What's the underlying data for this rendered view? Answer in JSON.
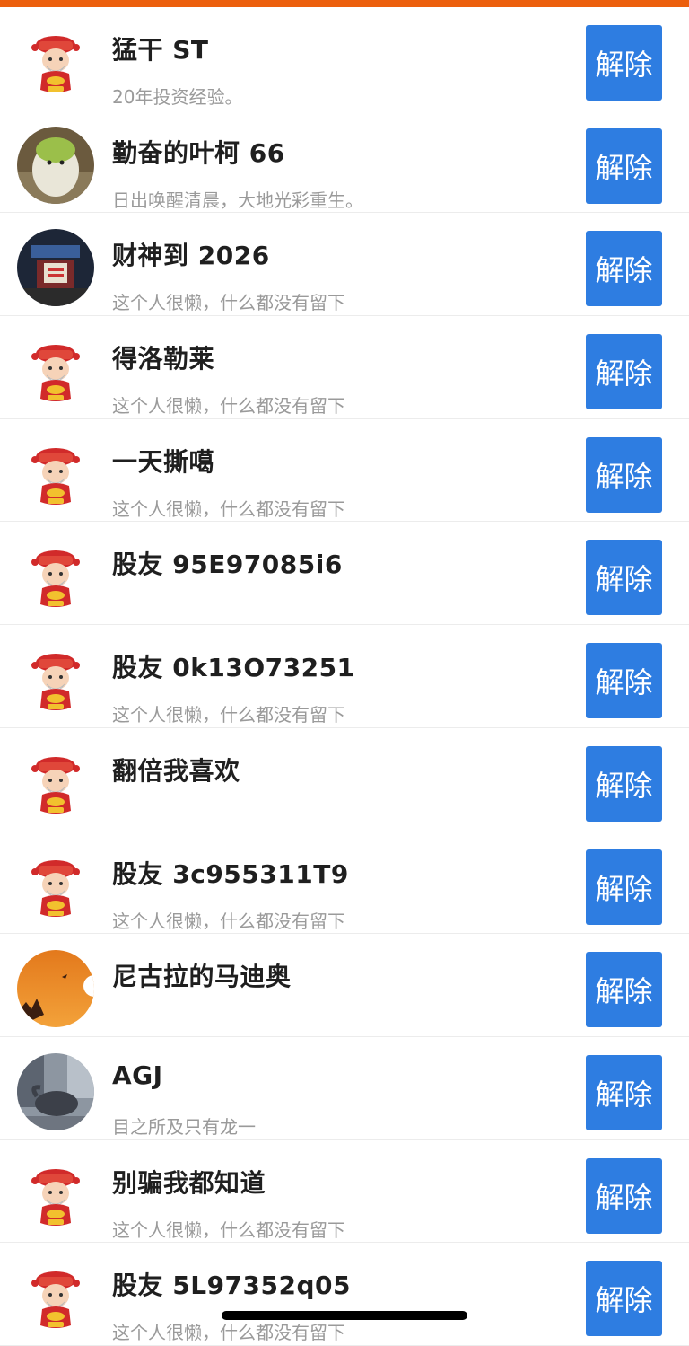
{
  "colors": {
    "accent_top": "#ec5f0d",
    "button_bg": "#2e7de1",
    "name_text": "#1f1f1f",
    "bio_text": "#9a9a9a"
  },
  "remove_label": "解除",
  "rows": [
    {
      "name": "猛干 ST",
      "bio": "20年投资经验。",
      "avatar": "caishen-avatar"
    },
    {
      "name": "勤奋的叶柯 66",
      "bio": "日出唤醒清晨，大地光彩重生。",
      "avatar": "plush-avatar"
    },
    {
      "name": "财神到 2026",
      "bio": "这个人很懒，什么都没有留下",
      "avatar": "night-photo-avatar"
    },
    {
      "name": "得洛勒莱",
      "bio": "这个人很懒，什么都没有留下",
      "avatar": "caishen-avatar"
    },
    {
      "name": "一天撕噶",
      "bio": "这个人很懒，什么都没有留下",
      "avatar": "caishen-avatar"
    },
    {
      "name": "股友 95E97085i6",
      "bio": "",
      "avatar": "caishen-avatar"
    },
    {
      "name": "股友 0k13O73251",
      "bio": "这个人很懒，什么都没有留下",
      "avatar": "caishen-avatar"
    },
    {
      "name": "翻倍我喜欢",
      "bio": "",
      "avatar": "caishen-avatar"
    },
    {
      "name": "股友 3c955311T9",
      "bio": "这个人很懒，什么都没有留下",
      "avatar": "caishen-avatar"
    },
    {
      "name": "尼古拉的马迪奥",
      "bio": "",
      "avatar": "sunset-avatar"
    },
    {
      "name": "AGJ",
      "bio": "目之所及只有龙一",
      "avatar": "bull-statue-avatar"
    },
    {
      "name": "别骗我都知道",
      "bio": "这个人很懒，什么都没有留下",
      "avatar": "caishen-avatar"
    },
    {
      "name": "股友 5L97352q05",
      "bio": "这个人很懒，什么都没有留下",
      "avatar": "caishen-avatar"
    }
  ]
}
